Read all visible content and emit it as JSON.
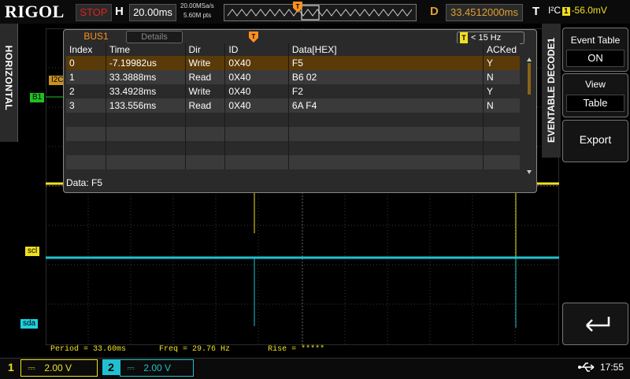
{
  "top": {
    "logo": "RIGOL",
    "run_status": "STOP",
    "h_label": "H",
    "timebase": "20.00ms",
    "sample_rate": "20.00MSa/s",
    "mem_depth": "5.60M pts",
    "d_label": "D",
    "trigger_position": "33.4512000ms",
    "t_label": "T",
    "trigger_type": "I²C",
    "trigger_source": "1",
    "trigger_level": "-56.0mV"
  },
  "left_tab": {
    "label": "HORIZONTAL"
  },
  "markers": {
    "i2c": "I2C",
    "b1": "B1",
    "scl": "scl",
    "sda": "sda"
  },
  "decode_panel": {
    "tab_active": "BUS1",
    "tab_inactive": "Details",
    "rate_label": "< 15 Hz",
    "rate_icon": "T",
    "columns": [
      "Index",
      "Time",
      "Dir",
      "ID",
      "Data[HEX]",
      "ACKed"
    ],
    "rows": [
      [
        "0",
        "-7.19982us",
        "Write",
        "0X40",
        "F5",
        "Y"
      ],
      [
        "1",
        "33.3888ms",
        "Read",
        "0X40",
        "B6 02",
        "N"
      ],
      [
        "2",
        "33.4928ms",
        "Write",
        "0X40",
        "F2",
        "Y"
      ],
      [
        "3",
        "133.556ms",
        "Read",
        "0X40",
        "6A F4",
        "N"
      ]
    ],
    "data_line": "Data: F5"
  },
  "right_menu": {
    "tab_label_decode": "DECODE1",
    "tab_label_evt": "EVENTABLE",
    "event_table": {
      "title": "Event Table",
      "value": "ON"
    },
    "view": {
      "title": "View",
      "value": "Table"
    },
    "export": {
      "title": "Export"
    }
  },
  "measurements": {
    "period": "Period = 33.60ms",
    "freq": "Freq = 29.76 Hz",
    "rise": "Rise = *****"
  },
  "bottom": {
    "ch1_num": "1",
    "ch1_scale": "2.00 V",
    "ch2_num": "2",
    "ch2_scale": "2.00 V",
    "coupling_symbol": "⎓",
    "time": "17:55"
  },
  "colors": {
    "ch1": "#f0e020",
    "ch2": "#20c0d0",
    "accent_orange": "#ff9020",
    "stop_red": "#e02020"
  }
}
